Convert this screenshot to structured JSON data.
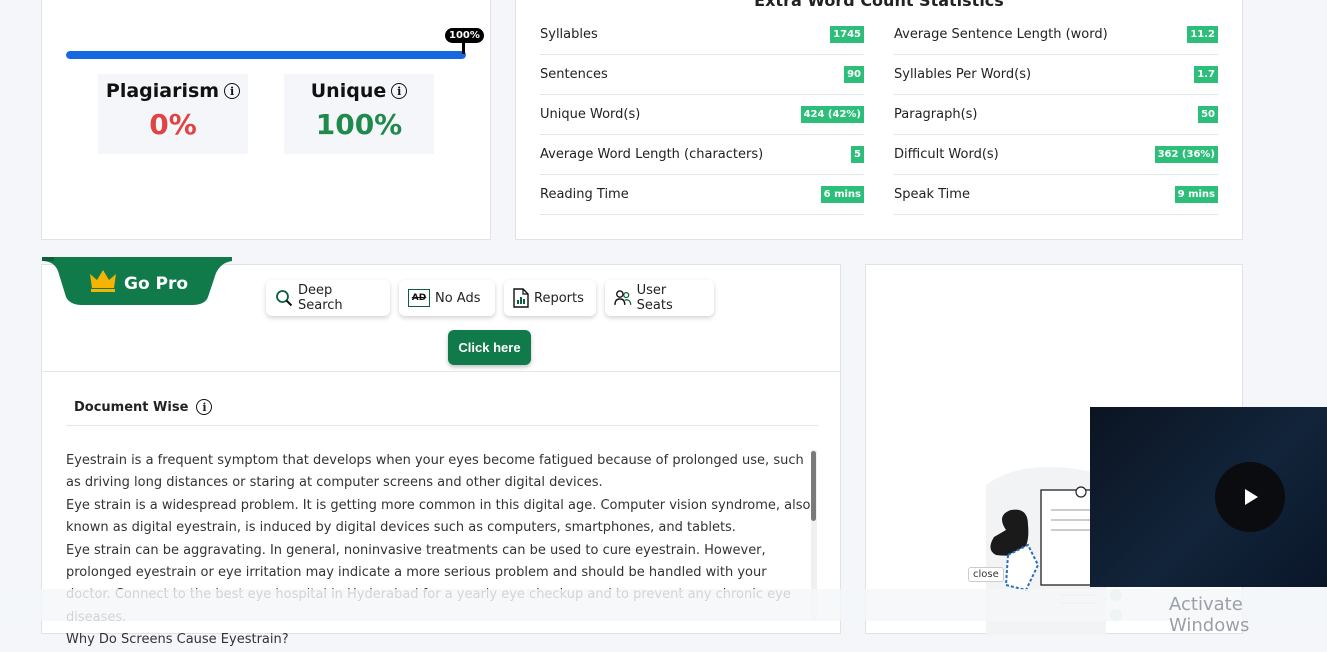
{
  "result": {
    "progress_label": "100%",
    "progress_fraction": 1.0,
    "plagiarism_label": "Plagiarism",
    "plagiarism_value": "0%",
    "unique_label": "Unique",
    "unique_value": "100%",
    "info_glyph": "i",
    "colors": {
      "plagiarism": "#e04343",
      "unique": "#1f8a4c",
      "progress": "#1668e0"
    }
  },
  "stats": {
    "title": "Extra Word Count Statistics",
    "left": [
      {
        "label": "Syllables",
        "value": "1745"
      },
      {
        "label": "Sentences",
        "value": "90"
      },
      {
        "label": "Unique Word(s)",
        "value": "424 (42%)"
      },
      {
        "label": "Average Word Length (characters)",
        "value": "5"
      },
      {
        "label": "Reading Time",
        "value": "6 mins"
      }
    ],
    "right": [
      {
        "label": "Average Sentence Length (word)",
        "value": "11.2"
      },
      {
        "label": "Syllables Per Word(s)",
        "value": "1.7"
      },
      {
        "label": "Paragraph(s)",
        "value": "50"
      },
      {
        "label": "Difficult Word(s)",
        "value": "362 (36%)"
      },
      {
        "label": "Speak Time",
        "value": "9 mins"
      }
    ]
  },
  "go_pro": {
    "label": "Go Pro",
    "features": {
      "deep_search": "Deep Search",
      "no_ads": "No Ads",
      "no_ads_icon_text": "AD",
      "reports": "Reports",
      "user_seats": "User Seats"
    },
    "cta": "Click here"
  },
  "document": {
    "heading": "Document Wise",
    "text": "Eyestrain is a frequent symptom that develops when your eyes become fatigued because of prolonged use, such as driving long distances or staring at computer screens and other digital devices.\nEye strain is a widespread problem. It is getting more common in this digital age. Computer vision syndrome, also known as digital eyestrain, is induced by digital devices such as computers, smartphones, and tablets.\nEye strain can be aggravating. In general, noninvasive treatments can be used to cure eyestrain. However, prolonged eyestrain or eye irritation may indicate a more serious problem and should be handled with your doctor. Connect to the best eye hospital in Hyderabad for a yearly eye checkup and to prevent any chronic eye diseases.\nWhy Do Screens Cause Eyestrain?"
  },
  "video": {
    "close": "close"
  },
  "watermark": "Activate Windows",
  "icons": [
    "info-icon",
    "crown-icon",
    "search-icon",
    "ad-icon",
    "report-icon",
    "user-seats-icon",
    "play-icon"
  ]
}
